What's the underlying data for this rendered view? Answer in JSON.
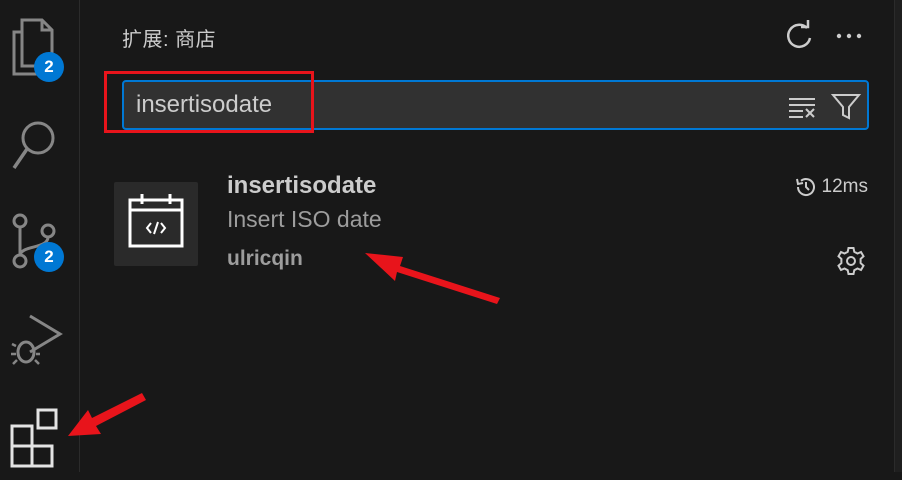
{
  "activity_bar": {
    "explorer_badge": "2",
    "scm_badge": "2"
  },
  "sidebar": {
    "title": "扩展: 商店"
  },
  "search": {
    "value": "insertisodate"
  },
  "extension": {
    "name": "insertisodate",
    "description": "Insert ISO date",
    "publisher": "ulricqin",
    "duration": "12ms"
  },
  "colors": {
    "accent": "#0078d4",
    "annotation": "#e8141b",
    "background": "#181818"
  }
}
